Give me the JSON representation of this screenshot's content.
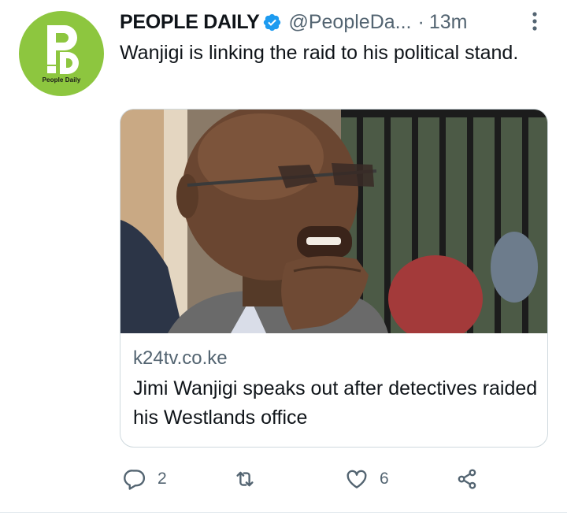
{
  "tweet": {
    "author_name": "PEOPLE DAILY",
    "handle": "@PeopleDa...",
    "separator": "·",
    "time": "13m",
    "text": "Wanjigi is linking the raid to his political stand.",
    "avatar_brand": "People Daily",
    "avatar_color": "#8dc63f",
    "verified_color": "#1d9bf0"
  },
  "link_card": {
    "image": "man-in-sunglasses-photo",
    "domain": "k24tv.co.ke",
    "title": "Jimi Wanjigi speaks out after detectives raided his Westlands office"
  },
  "actions": {
    "reply_count": "2",
    "retweet_count": "",
    "like_count": "6",
    "icons": [
      "reply-icon",
      "retweet-icon",
      "like-icon",
      "share-icon"
    ]
  }
}
